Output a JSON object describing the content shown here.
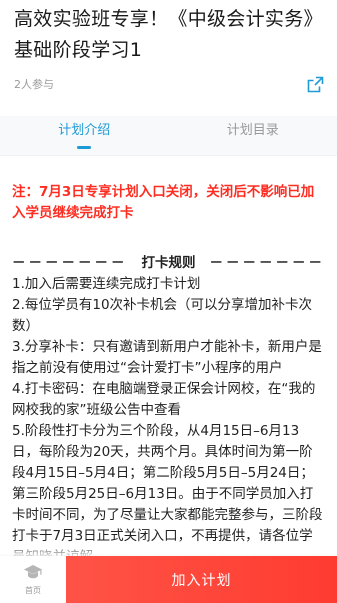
{
  "header": {
    "title": "高效实验班专享！《中级会计实务》基础阶段学习1",
    "participants": "2人参与"
  },
  "icons": {
    "share": "share-external-icon",
    "home": "graduation-cap-home-icon"
  },
  "colors": {
    "accent": "#1e9bd7",
    "notice": "#ff2d21",
    "cta": "#ff3b30"
  },
  "tabs": [
    {
      "label": "计划介绍",
      "active": true
    },
    {
      "label": "计划目录",
      "active": false
    }
  ],
  "notice": "注：7月3日专享计划入口关闭，关闭后不影响已加入学员继续完成打卡",
  "rules": {
    "dash_left": "－－－－－－－",
    "heading": "打卡规则",
    "dash_right": "－－－－－－－",
    "items": [
      "1.加入后需要连续完成打卡计划",
      "2.每位学员有10次补卡机会（可以分享增加补卡次数）",
      "3.分享补卡：只有邀请到新用户才能补卡，新用户是指之前没有使用过“会计爱打卡”小程序的用户",
      "4.打卡密码：在电脑端登录正保会计网校，在“我的网校我的家”班级公告中查看",
      "5.阶段性打卡分为三个阶段，从4月15日–6月13日，每阶段为20天，共两个月。具体时间为第一阶段4月15日–5月4日；第二阶段5月5日–5月24日；第三阶段5月25日–6月13日。由于不同学员加入打卡时间不同，为了尽量让大家都能完整参与，三阶段打卡于7月3日正式关闭入口，不再提供，请各位学员知晓并谅解。"
    ]
  },
  "bottom": {
    "home_label": "首页",
    "join_label": "加入计划"
  }
}
